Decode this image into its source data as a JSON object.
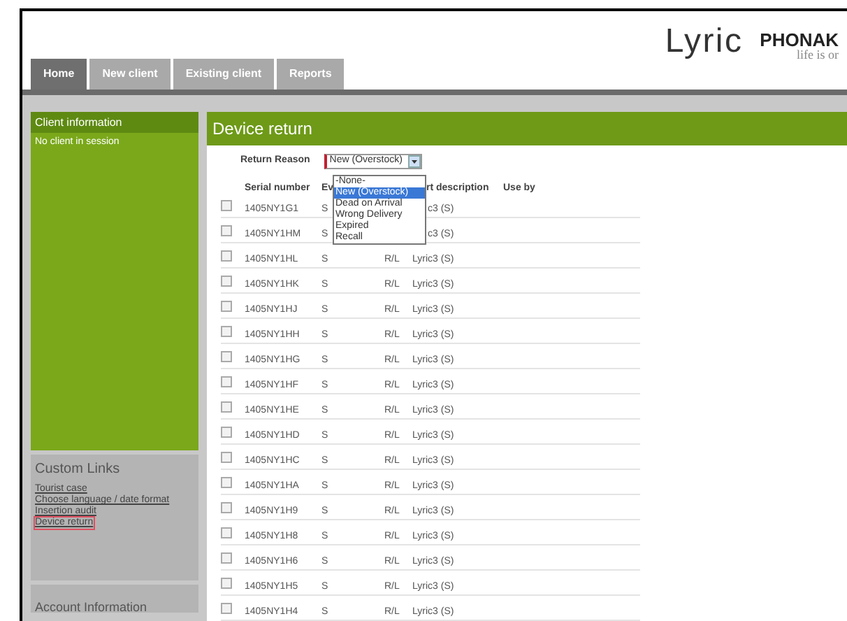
{
  "header": {
    "logo": "Lyric",
    "brand": "PHONAK",
    "tagline": "life is or"
  },
  "tabs": [
    {
      "label": "Home",
      "selected": true
    },
    {
      "label": "New client",
      "selected": false
    },
    {
      "label": "Existing client",
      "selected": false
    },
    {
      "label": "Reports",
      "selected": false
    }
  ],
  "sidebar": {
    "client_panel": {
      "title": "Client information",
      "text": "No client in session"
    },
    "links_panel": {
      "title": "Custom Links",
      "links": [
        {
          "label": "Tourist case",
          "selected": false
        },
        {
          "label": "Choose language / date format",
          "selected": false
        },
        {
          "label": "Insertion audit",
          "selected": false
        },
        {
          "label": "Device return",
          "selected": true
        }
      ]
    },
    "account_panel": {
      "title": "Account Information"
    }
  },
  "main": {
    "title": "Device return",
    "return_reason": {
      "label": "Return Reason",
      "value": "New (Overstock)",
      "options": [
        {
          "label": "-None-",
          "selected": false
        },
        {
          "label": "New (Overstock)",
          "selected": true
        },
        {
          "label": "Dead on Arrival",
          "selected": false
        },
        {
          "label": "Wrong Delivery",
          "selected": false
        },
        {
          "label": "Expired",
          "selected": false
        },
        {
          "label": "Recall",
          "selected": false
        }
      ]
    },
    "table": {
      "columns": [
        "Serial number",
        "Ev",
        "",
        "rt description",
        "Use by"
      ],
      "rows": [
        {
          "checked": false,
          "cells": [
            "1405NY1G1",
            "S",
            "",
            "c3 (S)",
            ""
          ]
        },
        {
          "checked": false,
          "cells": [
            "1405NY1HM",
            "S",
            "",
            "c3 (S)",
            ""
          ]
        },
        {
          "checked": false,
          "cells": [
            "1405NY1HL",
            "S",
            "R/L",
            "Lyric3 (S)",
            ""
          ]
        },
        {
          "checked": false,
          "cells": [
            "1405NY1HK",
            "S",
            "R/L",
            "Lyric3 (S)",
            ""
          ]
        },
        {
          "checked": false,
          "cells": [
            "1405NY1HJ",
            "S",
            "R/L",
            "Lyric3 (S)",
            ""
          ]
        },
        {
          "checked": false,
          "cells": [
            "1405NY1HH",
            "S",
            "R/L",
            "Lyric3 (S)",
            ""
          ]
        },
        {
          "checked": false,
          "cells": [
            "1405NY1HG",
            "S",
            "R/L",
            "Lyric3 (S)",
            ""
          ]
        },
        {
          "checked": false,
          "cells": [
            "1405NY1HF",
            "S",
            "R/L",
            "Lyric3 (S)",
            ""
          ]
        },
        {
          "checked": false,
          "cells": [
            "1405NY1HE",
            "S",
            "R/L",
            "Lyric3 (S)",
            ""
          ]
        },
        {
          "checked": false,
          "cells": [
            "1405NY1HD",
            "S",
            "R/L",
            "Lyric3 (S)",
            ""
          ]
        },
        {
          "checked": false,
          "cells": [
            "1405NY1HC",
            "S",
            "R/L",
            "Lyric3 (S)",
            ""
          ]
        },
        {
          "checked": false,
          "cells": [
            "1405NY1HA",
            "S",
            "R/L",
            "Lyric3 (S)",
            ""
          ]
        },
        {
          "checked": false,
          "cells": [
            "1405NY1H9",
            "S",
            "R/L",
            "Lyric3 (S)",
            ""
          ]
        },
        {
          "checked": false,
          "cells": [
            "1405NY1H8",
            "S",
            "R/L",
            "Lyric3 (S)",
            ""
          ]
        },
        {
          "checked": false,
          "cells": [
            "1405NY1H6",
            "S",
            "R/L",
            "Lyric3 (S)",
            ""
          ]
        },
        {
          "checked": false,
          "cells": [
            "1405NY1H5",
            "S",
            "R/L",
            "Lyric3 (S)",
            ""
          ]
        },
        {
          "checked": false,
          "cells": [
            "1405NY1H4",
            "S",
            "R/L",
            "Lyric3 (S)",
            ""
          ]
        }
      ]
    }
  }
}
